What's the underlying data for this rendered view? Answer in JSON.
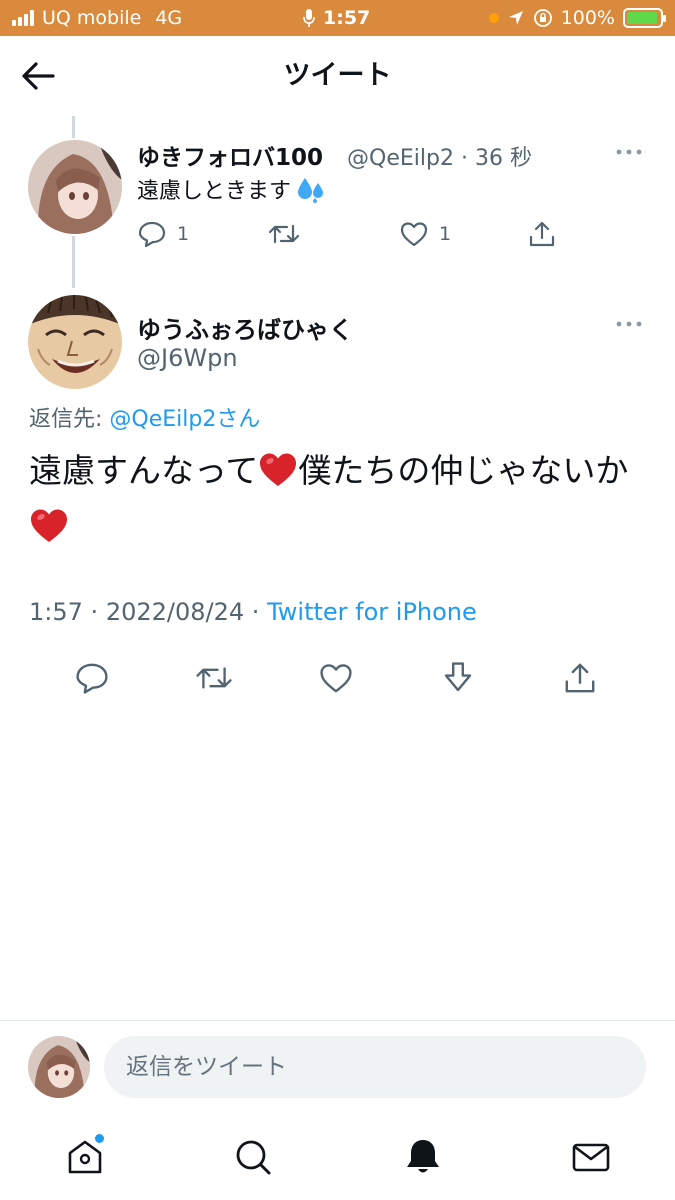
{
  "status_bar": {
    "carrier": "UQ mobile",
    "network": "4G",
    "time": "1:57",
    "battery": "100%",
    "background_color": "#d98a3c"
  },
  "header": {
    "title": "ツイート",
    "back_icon": "arrow-left-icon"
  },
  "parent_tweet": {
    "display_name": "ゆきフォロバ100",
    "handle": "@QeEilp2",
    "separator": "·",
    "time_ago": "36 秒",
    "text": "遠慮しときます",
    "emoji_icon": "sweat-droplets-icon",
    "reply_count": "1",
    "like_count": "1"
  },
  "main_tweet": {
    "display_name": "ゆうふぉろばひゃく",
    "handle": "@J6Wpn",
    "reply_to_label": "返信先:",
    "reply_to_mention": "@QeEilp2",
    "reply_to_suffix": "さん",
    "text_part1": "遠慮すんなって",
    "text_part2": "僕たちの仲じゃないか",
    "heart_color": "#d8232a",
    "time": "1:57",
    "date": "2022/08/24",
    "source": "Twitter for iPhone",
    "dot": "·"
  },
  "reply_bar": {
    "placeholder": "返信をツイート"
  },
  "tab_bar": {
    "items": [
      "home-icon",
      "search-icon",
      "bell-icon",
      "mail-icon"
    ],
    "accent": "#1d9bf0"
  }
}
